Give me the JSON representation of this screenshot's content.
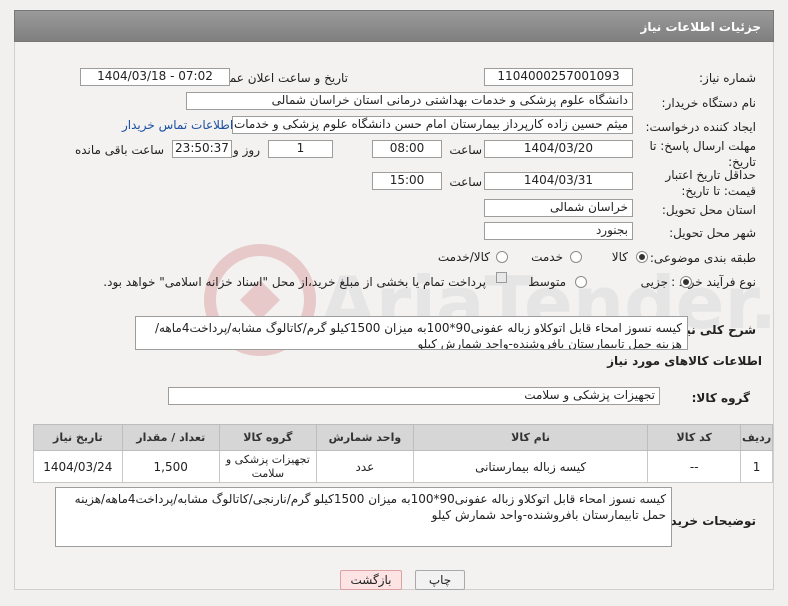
{
  "header": {
    "title": "جزئیات اطلاعات نیاز"
  },
  "fields": {
    "need_number_label": "شماره نیاز:",
    "need_number": "1104000257001093",
    "announce_label": "تاریخ و ساعت اعلان عمومی:",
    "announce_value": "1404/03/18 - 07:02",
    "buyer_org_label": "نام دستگاه خریدار:",
    "buyer_org": "دانشگاه علوم پزشکی و خدمات بهداشتی درمانی استان خراسان شمالی",
    "requester_label": "ایجاد کننده درخواست:",
    "requester": "میثم  حسین زاده  کارپرداز بیمارستان امام حسن دانشگاه علوم پزشکی و خدمات",
    "contact_link": "اطلاعات تماس خریدار",
    "reply_deadline_label": "مهلت ارسال پاسخ: تا تاریخ:",
    "reply_date": "1404/03/20",
    "time_label": "ساعت",
    "reply_time": "08:00",
    "days_value": "1",
    "days_label": "روز و",
    "remaining_time": "23:50:37",
    "remaining_label": "ساعت باقی مانده",
    "price_validity_label": "حداقل تاریخ اعتبار قیمت: تا تاریخ:",
    "price_date": "1404/03/31",
    "price_time": "15:00",
    "province_label": "استان محل تحویل:",
    "province": "خراسان شمالی",
    "city_label": "شهر محل تحویل:",
    "city": "بجنورد",
    "category_label": "طبقه بندی موضوعی:",
    "category_options": [
      "کالا",
      "خدمت",
      "کالا/خدمت"
    ],
    "process_label": "نوع فرآیند خرید :",
    "process_options": [
      "جزیی",
      "متوسط"
    ],
    "process_note": "پرداخت تمام یا بخشی از مبلغ خرید،از محل \"اسناد خزانه اسلامی\" خواهد بود.",
    "description_label": "شرح کلی نیاز:",
    "description": "کیسه نسوز امحاء قابل اتوکلاو زباله عفونی90*100به میزان 1500کیلو گرم/کاتالوگ مشابه/پرداخت4ماهه/هزینه حمل تابیمارستان بافروشنده-واحد شمارش کیلو",
    "goods_info_title": "اطلاعات کالاهای مورد نیاز",
    "goods_group_label": "گروه کالا:",
    "goods_group": "تجهیزات پزشکی و سلامت",
    "buyer_notes_label": "توضیحات خریدار:",
    "buyer_notes": "کیسه نسوز امحاء قابل اتوکلاو زباله عفونی90*100به میزان 1500کیلو گرم/نارنجی/کاتالوگ مشابه/پرداخت4ماهه/هزینه حمل تابیمارستان بافروشنده-واحد شمارش کیلو"
  },
  "table": {
    "headers": [
      "ردیف",
      "کد کالا",
      "نام کالا",
      "واحد شمارش",
      "گروه کالا",
      "تعداد / مقدار",
      "تاریخ نیاز"
    ],
    "rows": [
      [
        "1",
        "--",
        "کیسه زباله بیمارستانی",
        "عدد",
        "تجهیزات پزشکی و سلامت",
        "1,500",
        "1404/03/24"
      ]
    ]
  },
  "buttons": {
    "print": "چاپ",
    "back": "بازگشت"
  },
  "watermark": "AriaTender.net"
}
